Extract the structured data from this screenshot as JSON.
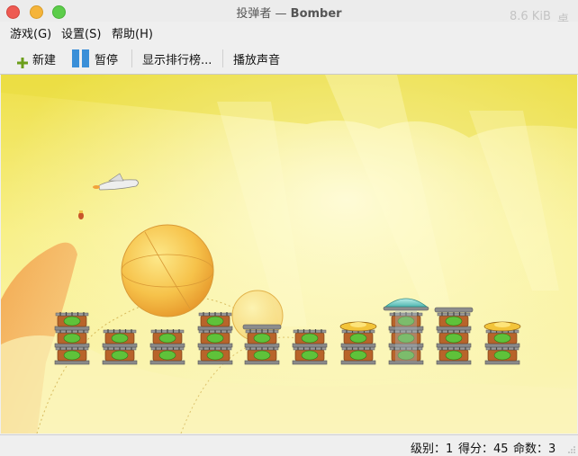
{
  "window": {
    "title_prefix": "投弹者 — ",
    "title_app": "Bomber",
    "background_text_1": "8.6 KiB",
    "background_text_2": "桌面"
  },
  "menu": {
    "game": "游戏(G)",
    "settings": "设置(S)",
    "help": "帮助(H)"
  },
  "toolbar": {
    "new_label": "新建",
    "pause_label": "暂停",
    "highscores_label": "显示排行榜...",
    "sound_label": "播放声音"
  },
  "status": {
    "level_label": "级别：",
    "level": "1",
    "score_label": "得分：",
    "score": "45",
    "lives_label": "命数：",
    "lives": "3"
  },
  "icons": {
    "new": "plus-icon",
    "pause": "pause-icon",
    "plane": "plane-icon",
    "bomb": "bomb-icon",
    "resize": "resize-grip-icon"
  },
  "colors": {
    "accent_blue": "#3a8fd8",
    "plus_green": "#6b9e1a",
    "sky_top": "#f4e24a",
    "sky_bottom": "#fbf6b6",
    "close": "#ee5a52",
    "minimize": "#f5b43a",
    "maximize": "#5ccd4a"
  }
}
